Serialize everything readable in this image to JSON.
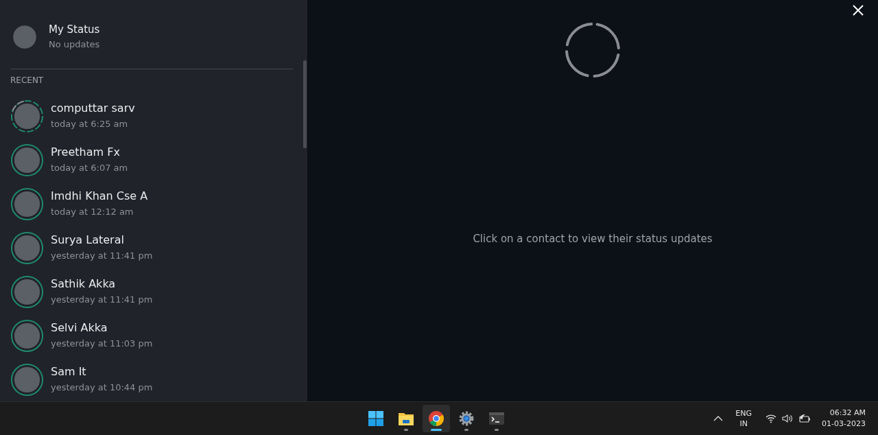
{
  "my_status": {
    "name": "My Status",
    "subtitle": "No updates"
  },
  "section_label": "RECENT",
  "contacts": [
    {
      "name": "computtar sarv",
      "time": "today at 6:25 am",
      "partly_seen": true
    },
    {
      "name": "Preetham Fx",
      "time": "today at 6:07 am",
      "partly_seen": false
    },
    {
      "name": "Imdhi Khan Cse A",
      "time": "today at 12:12 am",
      "partly_seen": false
    },
    {
      "name": "Surya Lateral",
      "time": "yesterday at 11:41 pm",
      "partly_seen": false
    },
    {
      "name": "Sathik Akka",
      "time": "yesterday at 11:41 pm",
      "partly_seen": false
    },
    {
      "name": "Selvi Akka",
      "time": "yesterday at 11:03 pm",
      "partly_seen": false
    },
    {
      "name": "Sam It",
      "time": "yesterday at 10:44 pm",
      "partly_seen": false
    }
  ],
  "main": {
    "hint": "Click on a contact to view their status updates"
  },
  "taskbar": {
    "apps": [
      {
        "kind": "start",
        "selected": false,
        "running": false
      },
      {
        "kind": "folder",
        "selected": false,
        "running": true
      },
      {
        "kind": "browser",
        "selected": true,
        "running": true
      },
      {
        "kind": "settings",
        "selected": false,
        "running": true
      },
      {
        "kind": "terminal",
        "selected": false,
        "running": true
      }
    ],
    "language": "ENG",
    "region": "IN",
    "time": "06:32 AM",
    "date": "01-03-2023"
  }
}
